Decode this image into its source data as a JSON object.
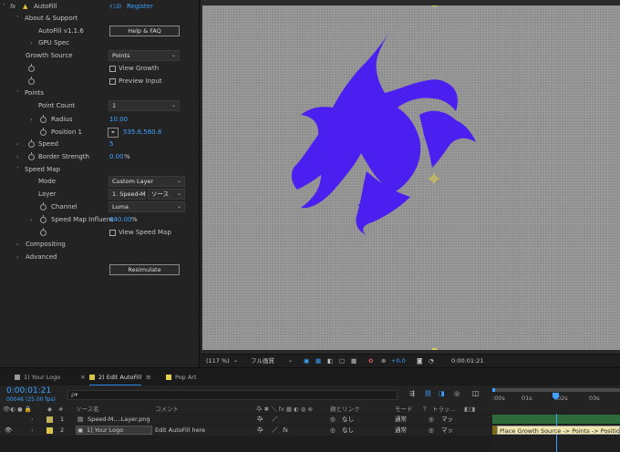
{
  "effect": {
    "fx": "fx",
    "name": "AutoFill",
    "links": [
      "ｲﾝｽﾄ",
      "Register"
    ]
  },
  "about": {
    "header": "About & Support",
    "version": "AutoFill v1.1.6",
    "help_button": "Help & FAQ",
    "gpu": "GPU Spec"
  },
  "growth": {
    "label": "Growth Source",
    "value": "Points",
    "view_growth": "View Growth",
    "preview_input": "Preview Input"
  },
  "points": {
    "header": "Points",
    "count_label": "Point Count",
    "count_value": "1",
    "radius_label": "Radius",
    "radius_value": "10.00",
    "position_label": "Position 1",
    "position_value": "535.6,560.8"
  },
  "speed": {
    "label": "Speed",
    "value": "5"
  },
  "border": {
    "label": "Border Strength",
    "value": "0.00",
    "unit": "%"
  },
  "speed_map": {
    "header": "Speed Map",
    "mode_label": "Mode",
    "mode_value": "Custom Layer",
    "layer_label": "Layer",
    "layer_value": "1. Speed-M",
    "layer_source": "ソース",
    "channel_label": "Channel",
    "channel_value": "Luma",
    "influence_label": "Speed Map Influenc",
    "influence_value": "640.00",
    "influence_unit": "%",
    "view_map": "View Speed Map"
  },
  "compositing": "Compositing",
  "advanced": "Advanced",
  "resimulate": "Resimulate",
  "viewer": {
    "zoom": "(117 %)",
    "resolution": "フル画質",
    "exposure": "+0.0",
    "timecode": "0:00:01:21"
  },
  "tabs": [
    {
      "label": "1) Your Logo",
      "color": "#9a9a9a"
    },
    {
      "label": "2) Edit AutoFill",
      "color": "#d6c34a"
    },
    {
      "label": "Pop Art",
      "color": "#e3d24e"
    }
  ],
  "timeline": {
    "timecode": "0:00:01:21",
    "frames": "00046 (25.00 fps)",
    "search_placeholder": "ρ▾",
    "col_source": "ソース名",
    "col_comment": "コメント",
    "col_parent": "親とリンク",
    "col_mode": "モード",
    "col_t": "T",
    "col_trkmat": "トラッ...",
    "ticks": [
      ":00s",
      "01s",
      "02s",
      "03s"
    ],
    "layers": [
      {
        "num": "1",
        "name": "Speed-M....Layer.png",
        "comment": "",
        "parent": "なし",
        "mode": "通常",
        "matte": "マッ",
        "label_color": "#c0b05a"
      },
      {
        "num": "2",
        "name": "1] Your Logo",
        "comment": "Edit AutoFill here",
        "parent": "なし",
        "mode": "通常",
        "matte": "マッ",
        "label_color": "#d8c44e"
      }
    ],
    "tooltip": "Place Growth Source -> Points -> Position of"
  },
  "colors": {
    "accent": "#2d8ceb",
    "value_blue": "#3ea2ff",
    "logo": "#4a1ff0",
    "canvas": "#8e8e8e"
  }
}
